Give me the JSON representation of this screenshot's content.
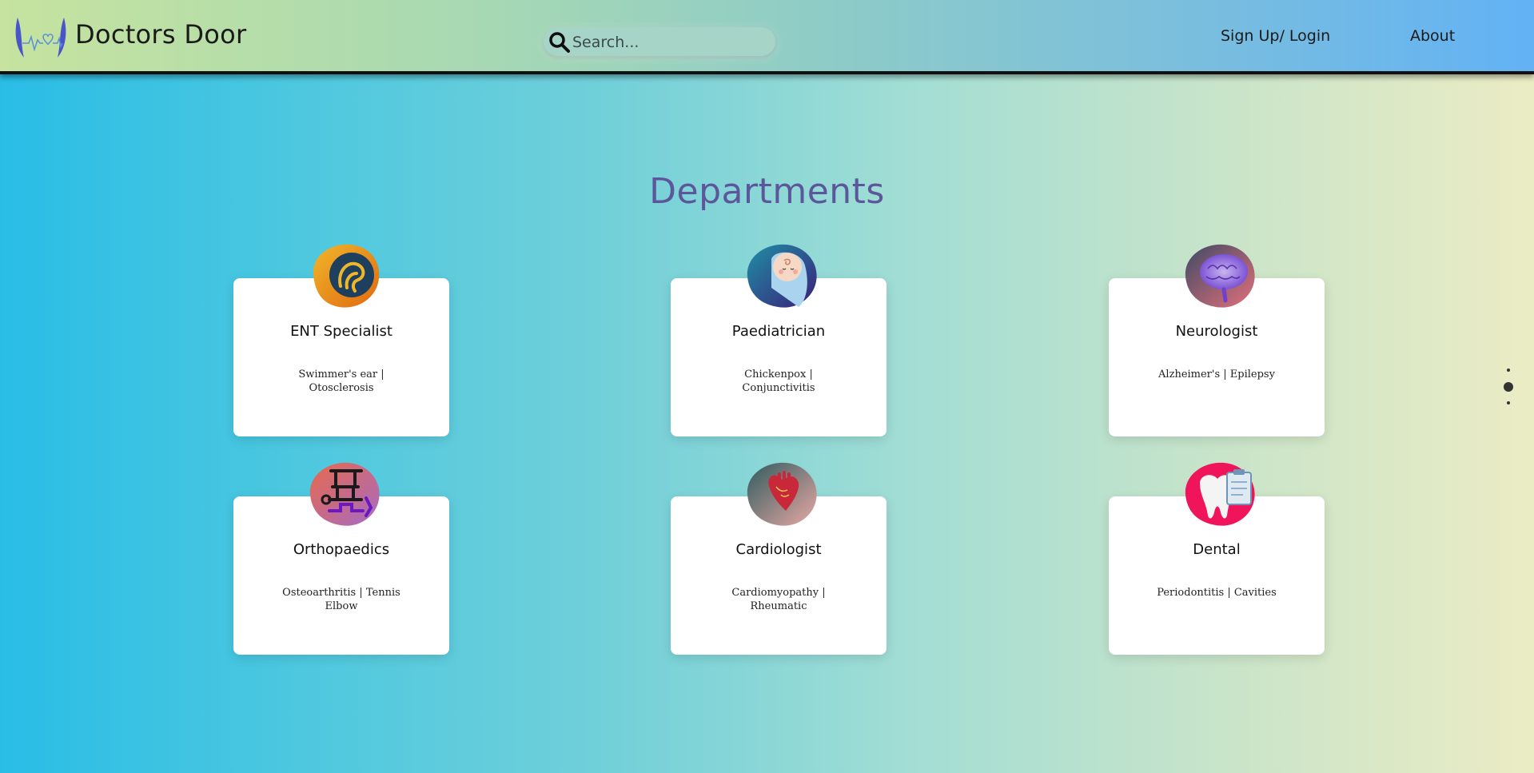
{
  "header": {
    "brand": "Doctors Door",
    "search_placeholder": "Search...",
    "nav": {
      "signup": "Sign Up/ Login",
      "about": "About"
    }
  },
  "departments": {
    "title": "Departments",
    "cards": [
      {
        "title": "ENT Specialist",
        "desc": "Swimmer's ear | Otosclerosis",
        "icon": "ent-ear-icon"
      },
      {
        "title": "Paediatrician",
        "desc": "Chickenpox | Conjunctivitis",
        "icon": "baby-icon"
      },
      {
        "title": "Neurologist",
        "desc": "Alzheimer's | Epilepsy",
        "icon": "brain-icon"
      },
      {
        "title": "Orthopaedics",
        "desc": "Osteoarthritis | Tennis Elbow",
        "icon": "bone-joint-icon"
      },
      {
        "title": "Cardiologist",
        "desc": "Cardiomyopathy | Rheumatic",
        "icon": "heart-icon"
      },
      {
        "title": "Dental",
        "desc": "Periodontitis | Cavities",
        "icon": "tooth-icon"
      }
    ]
  },
  "carousel": {
    "dots": 3,
    "active_dot": 2
  },
  "colors": {
    "title": "#5b579a",
    "logo": "#4a55c8"
  }
}
